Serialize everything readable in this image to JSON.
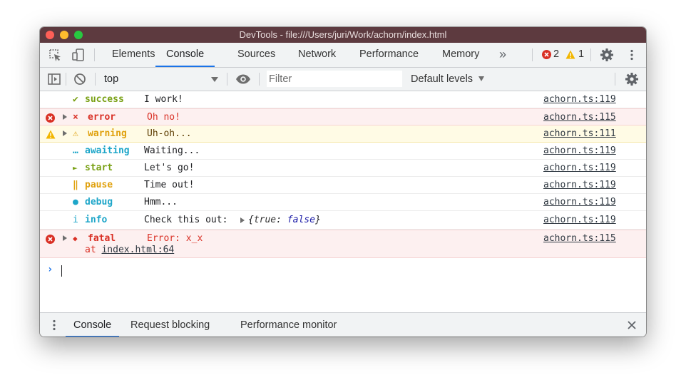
{
  "window": {
    "title": "DevTools - file:///Users/juri/Work/achorn/index.html"
  },
  "tabs": [
    {
      "label": "Elements",
      "active": false
    },
    {
      "label": "Console",
      "active": true
    },
    {
      "label": "Sources",
      "active": false
    },
    {
      "label": "Network",
      "active": false
    },
    {
      "label": "Performance",
      "active": false
    },
    {
      "label": "Memory",
      "active": false
    }
  ],
  "tabbar": {
    "overflow_glyph": "»",
    "error_count": "2",
    "warning_count": "1"
  },
  "toolbar": {
    "context": "top",
    "filter_placeholder": "Filter",
    "levels": "Default levels"
  },
  "colors": {
    "accent": "#1a73e8",
    "error": "#d93025",
    "warning": "#e0a10e",
    "success": "#7aa116",
    "info": "#1ea6c9"
  },
  "messages": [
    {
      "level": "success",
      "glyph": "✔",
      "name": "success",
      "message": "I work!",
      "source": "achorn.ts:119"
    },
    {
      "level": "error",
      "glyph": "×",
      "name": "error",
      "message": "Oh no!",
      "source": "achorn.ts:115"
    },
    {
      "level": "warning",
      "glyph": "⚠",
      "name": "warning",
      "message": "Uh-oh...",
      "source": "achorn.ts:111"
    },
    {
      "level": "awaiting",
      "glyph": "…",
      "name": "awaiting",
      "message": "Waiting...",
      "source": "achorn.ts:119"
    },
    {
      "level": "start",
      "glyph": "►",
      "name": "start",
      "message": "Let's go!",
      "source": "achorn.ts:119"
    },
    {
      "level": "pause",
      "glyph": "‖",
      "name": "pause",
      "message": "Time out!",
      "source": "achorn.ts:119"
    },
    {
      "level": "debug",
      "glyph": "●",
      "name": "debug",
      "message": "Hmm...",
      "source": "achorn.ts:119"
    },
    {
      "level": "info",
      "glyph": "i",
      "name": "info",
      "message": "Check this out:",
      "object_open": "{",
      "object_key": "true",
      "object_colon": ":",
      "object_value": "false",
      "object_close": "}",
      "source": "achorn.ts:119"
    },
    {
      "level": "fatal",
      "glyph": "◆",
      "name": "fatal",
      "message": "Error: x_x",
      "stack_at": "at",
      "stack_link": "index.html:64",
      "source": "achorn.ts:115"
    }
  ],
  "console": {
    "prompt": "›"
  },
  "drawer": {
    "tabs": [
      {
        "label": "Console",
        "active": true
      },
      {
        "label": "Request blocking",
        "active": false
      },
      {
        "label": "Performance monitor",
        "active": false
      }
    ]
  }
}
